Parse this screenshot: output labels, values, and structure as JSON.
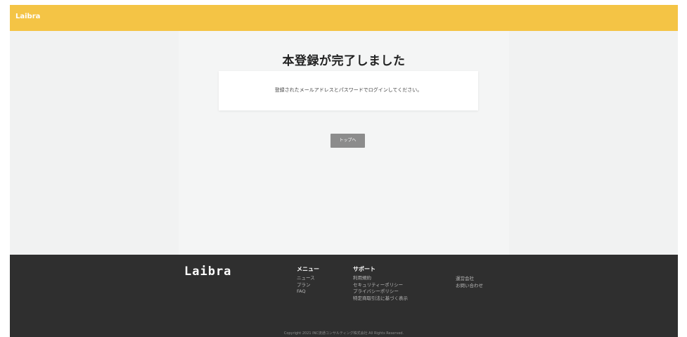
{
  "header": {
    "logo": "Laibra"
  },
  "main": {
    "title": "本登録が完了しました",
    "message": "登録されたメールアドレスとパスワードでログインしてください。",
    "top_button": "トップへ"
  },
  "footer": {
    "logo": "Laibra",
    "menu": {
      "heading": "メニュー",
      "items": [
        "ニュース",
        "プラン",
        "FAQ"
      ]
    },
    "support": {
      "heading": "サポート",
      "items": [
        "利用規約",
        "セキュリティーポリシー",
        "プライバシーポリシー",
        "特定商取引法に基づく表示"
      ]
    },
    "company": {
      "items": [
        "運営会社",
        "お問い合わせ"
      ]
    },
    "copyright": "Copyright 2021 INC流通コンサルティング株式会社 All Rights Reserved."
  },
  "colors": {
    "header_bg": "#f4c445",
    "footer_bg": "#2f2f2f",
    "button_bg": "#8c8c8c",
    "page_bg": "#f1f2f2"
  }
}
